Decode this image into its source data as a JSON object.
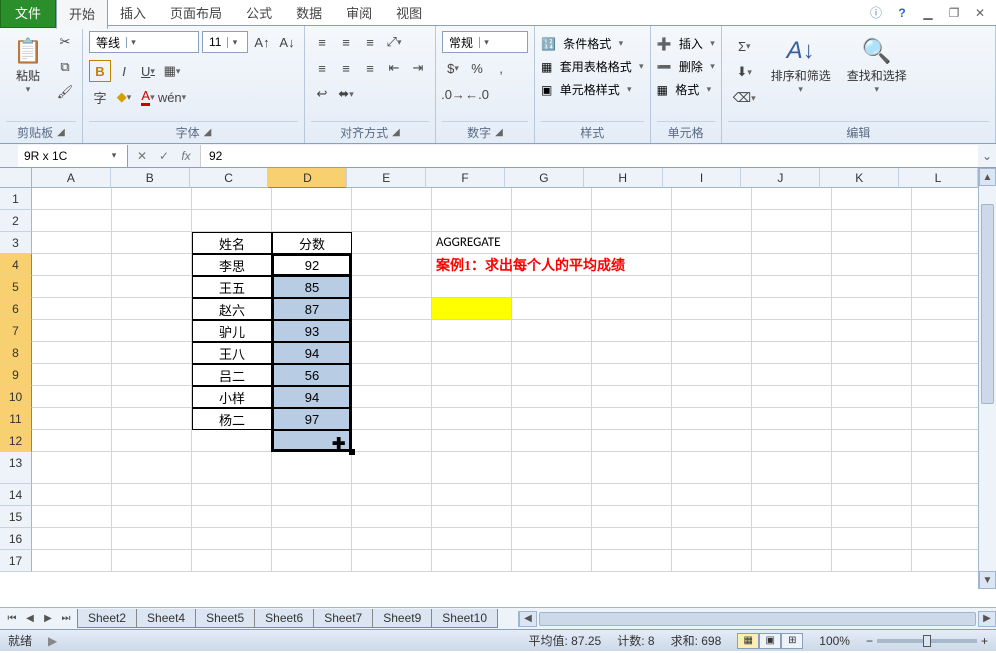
{
  "tabs": {
    "file": "文件",
    "home": "开始",
    "insert": "插入",
    "layout": "页面布局",
    "formula": "公式",
    "data": "数据",
    "review": "审阅",
    "view": "视图"
  },
  "ribbon": {
    "clipboard": {
      "paste": "粘贴",
      "label": "剪贴板"
    },
    "font": {
      "name": "等线",
      "size": "11",
      "label": "字体"
    },
    "align": {
      "label": "对齐方式"
    },
    "number": {
      "format": "常规",
      "label": "数字"
    },
    "styles": {
      "cond": "条件格式",
      "table": "套用表格格式",
      "cell": "单元格样式",
      "label": "样式"
    },
    "cells": {
      "insert": "插入",
      "delete": "删除",
      "format": "格式",
      "label": "单元格"
    },
    "editing": {
      "sort": "排序和筛选",
      "find": "查找和选择",
      "label": "编辑"
    }
  },
  "fbar": {
    "namebox": "9R x 1C",
    "formula": "92"
  },
  "columns": [
    "A",
    "B",
    "C",
    "D",
    "E",
    "F",
    "G",
    "H",
    "I",
    "J",
    "K",
    "L"
  ],
  "rows": [
    "1",
    "2",
    "3",
    "4",
    "5",
    "6",
    "7",
    "8",
    "9",
    "10",
    "11",
    "12",
    "13",
    "14",
    "15",
    "16",
    "17"
  ],
  "table": {
    "h1": "姓名",
    "h2": "分数",
    "n": [
      "李思",
      "王五",
      "赵六",
      "驴儿",
      "王八",
      "吕二",
      "小样",
      "杨二"
    ],
    "v": [
      "92",
      "85",
      "87",
      "93",
      "94",
      "56",
      "94",
      "97"
    ]
  },
  "notes": {
    "agg": "AGGREGATE",
    "case1": "案例1：求出每个人的平均成绩"
  },
  "sheets": [
    "Sheet2",
    "Sheet4",
    "Sheet5",
    "Sheet6",
    "Sheet7",
    "Sheet9",
    "Sheet10"
  ],
  "status": {
    "ready": "就绪",
    "avg": "平均值: 87.25",
    "count": "计数: 8",
    "sum": "求和: 698",
    "zoom": "100%"
  }
}
